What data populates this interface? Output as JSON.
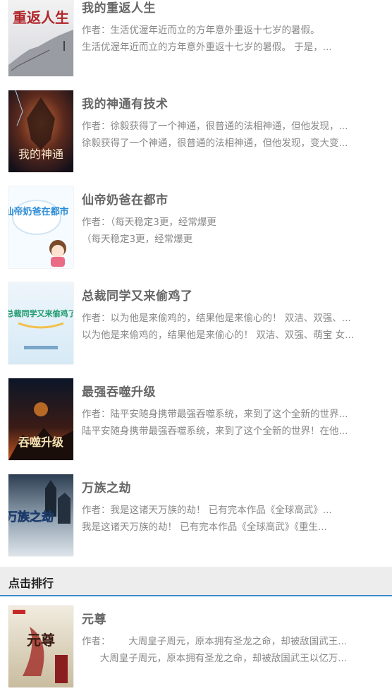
{
  "latest_books": [
    {
      "title": "我的重返人生",
      "author_prefix": "作者：",
      "author_text": "生活优渥年近而立的方年意外重返十七岁的暑假。",
      "description": "生活优渥年近而立的方年意外重返十七岁的暑假。      于是，...",
      "cover_text": "重返人生",
      "cover_colors": [
        "#f4f4f4",
        "#d9dadf"
      ]
    },
    {
      "title": "我的神通有技术",
      "author_prefix": "作者：",
      "author_text": "徐毅获得了一个神通，很普通的法相神通，但他发现，...",
      "description": "徐毅获得了一个神通，很普通的法相神通，但他发现，变大变...",
      "cover_text": "我的神通",
      "cover_colors": [
        "#5d2a1d",
        "#1f1320"
      ]
    },
    {
      "title": "仙帝奶爸在都市",
      "author_prefix": "作者：",
      "author_text": "（每天稳定3更，经常爆更",
      "description": "（每天稳定3更，经常爆更",
      "cover_text": "仙帝奶爸在都市",
      "cover_colors": [
        "#fbfdff",
        "#dfeefa"
      ]
    },
    {
      "title": "总裁同学又来偷鸡了",
      "author_prefix": "作者：",
      "author_text": "以为他是来偷鸡的，结果他是来偷心的！ 双洁、双强、...",
      "description": "以为他是来偷鸡的，结果他是来偷心的！ 双洁、双强、萌宝 女...",
      "cover_text": "总裁同学又来偷鸡了",
      "cover_colors": [
        "#f4f8fc",
        "#d4e8f5"
      ]
    },
    {
      "title": "最强吞噬升级",
      "author_prefix": "作者：",
      "author_text": "陆平安随身携带最强吞噬系统，来到了这个全新的世界...",
      "description": "陆平安随身携带最强吞噬系统，来到了这个全新的世界！在他...",
      "cover_text": "吞噬升级",
      "cover_colors": [
        "#0e1a2d",
        "#7a2a18"
      ]
    },
    {
      "title": "万族之劫",
      "author_prefix": "作者：",
      "author_text": "我是这诸天万族的劫！      已有完本作品《全球高武》...",
      "description": "我是这诸天万族的劫！      已有完本作品《全球高武》《重生...",
      "cover_text": "万族之劫",
      "cover_colors": [
        "#37475c",
        "#c9d4de"
      ]
    }
  ],
  "section": {
    "title": "点击排行"
  },
  "ranking_books": [
    {
      "title": "元尊",
      "author_prefix": "作者：",
      "author_text": "      大周皇子周元，原本拥有圣龙之命，却被敌国武王...",
      "description": "      大周皇子周元，原本拥有圣龙之命，却被敌国武王以亿万...",
      "cover_text": "元尊",
      "cover_colors": [
        "#f1ecdf",
        "#cfc3aa"
      ]
    }
  ]
}
